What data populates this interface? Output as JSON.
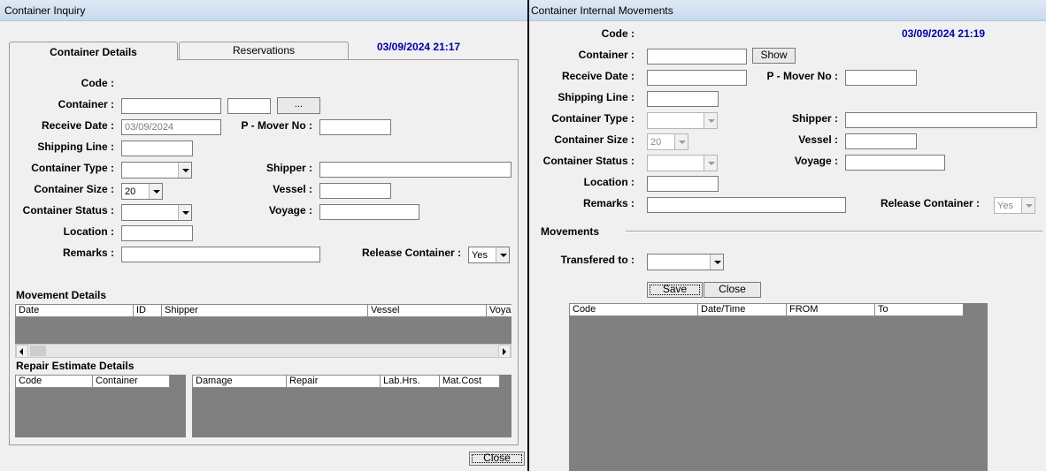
{
  "left": {
    "title": "Container Inquiry",
    "tabs": [
      "Container Details",
      "Reservations"
    ],
    "datetime": "03/09/2024 21:17",
    "labels": {
      "code": "Code :",
      "container": "Container :",
      "receive_date": "Receive Date :",
      "pmover": "P - Mover No :",
      "shipping_line": "Shipping Line :",
      "container_type": "Container Type :",
      "shipper": "Shipper :",
      "container_size": "Container Size :",
      "vessel": "Vessel :",
      "container_status": "Container Status :",
      "voyage": "Voyage :",
      "location": "Location :",
      "remarks": "Remarks :",
      "release_container": "Release Container :"
    },
    "values": {
      "receive_date": "03/09/2024",
      "container_size": "20",
      "release": "Yes"
    },
    "ellipsis": "...",
    "movement_title": "Movement Details",
    "movement_cols": [
      "Date",
      "ID",
      "Shipper",
      "Vessel",
      "Voya"
    ],
    "repair_title": "Repair Estimate Details",
    "repair_cols_a": [
      "Code",
      "Container"
    ],
    "repair_cols_b": [
      "Damage",
      "Repair",
      "Lab.Hrs.",
      "Mat.Cost"
    ],
    "close": "Close"
  },
  "right": {
    "title": "Container Internal Movements",
    "datetime": "03/09/2024 21:19",
    "labels": {
      "code": "Code :",
      "container": "Container :",
      "receive_date": "Receive Date :",
      "pmover": "P - Mover No :",
      "shipping_line": "Shipping Line :",
      "container_type": "Container Type :",
      "shipper": "Shipper :",
      "container_size": "Container Size :",
      "vessel": "Vessel :",
      "container_status": "Container Status :",
      "voyage": "Voyage :",
      "location": "Location :",
      "remarks": "Remarks :",
      "release_container": "Release Container :"
    },
    "values": {
      "container_size": "20",
      "release": "Yes"
    },
    "show": "Show",
    "movements_title": "Movements",
    "transfered_to": "Transfered to :",
    "save": "Save",
    "close": "Close",
    "grid_cols": [
      "Code",
      "Date/Time",
      "FROM",
      "To"
    ]
  }
}
